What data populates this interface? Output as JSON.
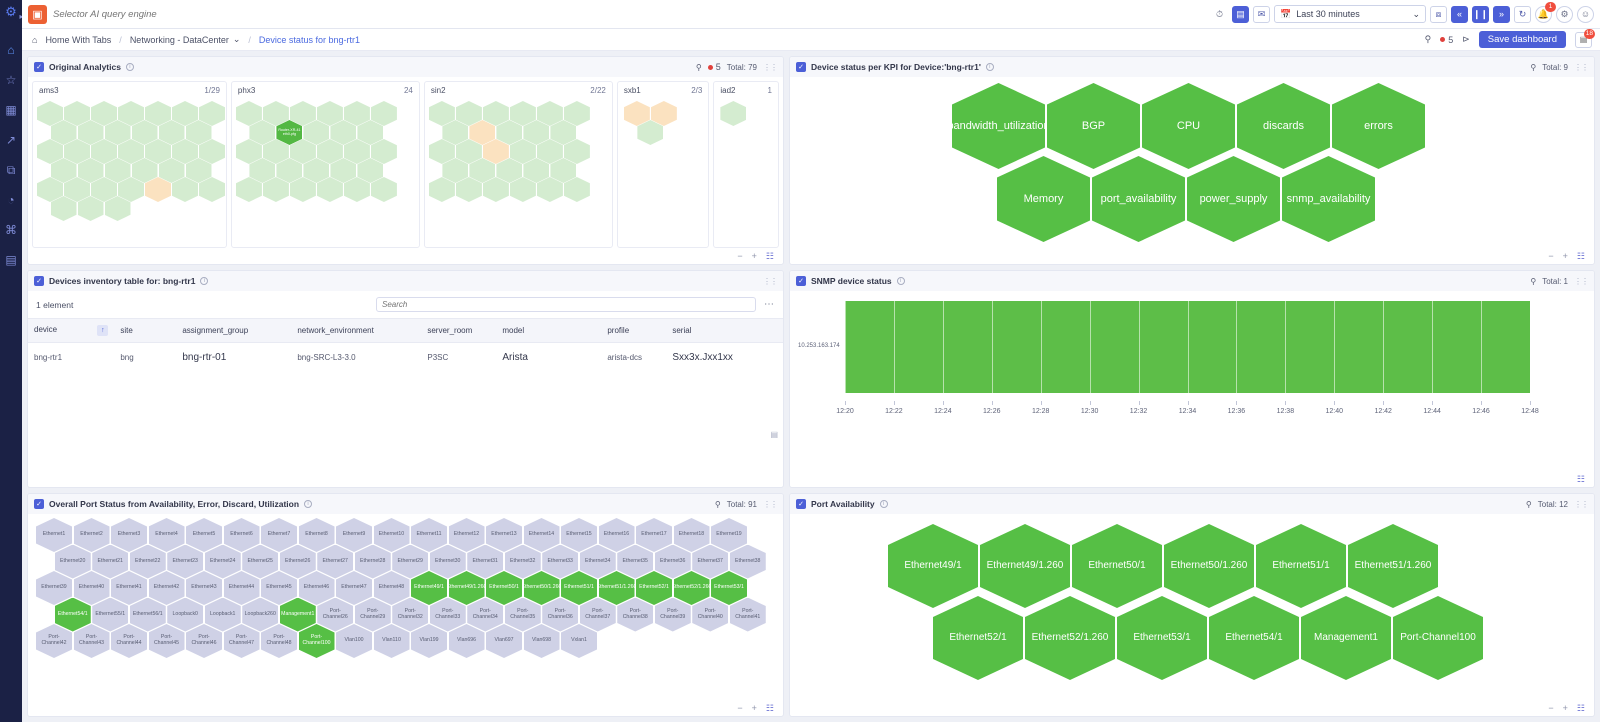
{
  "rail": {
    "logo_icon": "app-logo-icon",
    "collapse_icon": "chevron-right-icon",
    "items": [
      {
        "name": "home",
        "glyph": "⌂"
      },
      {
        "name": "favorites",
        "glyph": "☆"
      },
      {
        "name": "dashboards",
        "glyph": "▦"
      },
      {
        "name": "analytics",
        "glyph": "↗"
      },
      {
        "name": "integrations",
        "glyph": "⧉"
      },
      {
        "name": "alerts",
        "glyph": "◔"
      },
      {
        "name": "topology",
        "glyph": "⌘"
      },
      {
        "name": "documents",
        "glyph": "▤"
      }
    ]
  },
  "topbar": {
    "selector_icon": "selector-logo-icon",
    "query_placeholder": "Selector AI query engine",
    "history_icon": "clock-icon",
    "layout_icon": "layout-icon",
    "comment_icon": "comment-icon",
    "time_range": "Last 30 minutes",
    "calendar_icon": "calendar-icon",
    "chevron_icon": "chevron-down-icon",
    "zoom_out_icon": "zoom-out-icon",
    "prev_icon": "«",
    "pause_icon": "pause-icon",
    "next_icon": "»",
    "refresh_icon": "refresh-icon",
    "bell_icon": "bell-icon",
    "bell_badge": "1",
    "settings_icon": "gear-icon",
    "avatar_icon": "user-avatar-icon"
  },
  "breadcrumb": {
    "home_icon": "home-icon",
    "items": [
      "Home With Tabs",
      "Networking - DataCenter",
      "Device status for bng-rtr1"
    ],
    "separator": "/",
    "dropdown_icon": "chevron-down-icon",
    "search_icon": "search-icon",
    "alert_count": "5",
    "share_icon": "share-icon",
    "save_label": "Save dashboard",
    "grid_icon": "grid-icon",
    "grid_badge": "18"
  },
  "panels": {
    "original_analytics": {
      "title": "Original Analytics",
      "info_icon": "info-icon",
      "search_icon": "search-icon",
      "alert_count": "5",
      "total_label": "Total: 79",
      "drag_icon": "drag-handle-icon",
      "sites": [
        {
          "name": "ams3",
          "count": "1/29"
        },
        {
          "name": "phx3",
          "count": "24"
        },
        {
          "name": "sin2",
          "count": "2/22"
        },
        {
          "name": "sxb1",
          "count": "2/3"
        },
        {
          "name": "iad2",
          "count": "1"
        }
      ],
      "highlighted_node": "Router-XR-41 eth0-pfg",
      "footer": {
        "minus_icon": "zoom-out-icon",
        "plus_icon": "zoom-in-icon",
        "layout_icon": "layout-icon"
      }
    },
    "device_kpi": {
      "title": "Device status per KPI for Device:'bng-rtr1'",
      "info_icon": "info-icon",
      "search_icon": "search-icon",
      "total_label": "Total: 9",
      "drag_icon": "drag-handle-icon",
      "row1": [
        "bandwidth_utilization",
        "BGP",
        "CPU",
        "discards",
        "errors"
      ],
      "row2": [
        "Memory",
        "port_availability",
        "power_supply",
        "snmp_availability"
      ],
      "footer": {
        "minus_icon": "zoom-out-icon",
        "plus_icon": "zoom-in-icon",
        "layout_icon": "layout-icon"
      }
    },
    "inventory": {
      "title": "Devices inventory table for: bng-rtr1",
      "info_icon": "info-icon",
      "element_count": "1 element",
      "search_placeholder": "Search",
      "more_icon": "more-options-icon",
      "drag_icon": "drag-handle-icon",
      "sort_icon": "sort-ascending-icon",
      "columns": [
        "device",
        "site",
        "assignment_group",
        "network_environment",
        "server_room",
        "model",
        "profile",
        "serial"
      ],
      "rows": [
        {
          "device": "bng-rtr1",
          "site": "bng",
          "assignment_group": "bng-rtr-01",
          "network_environment": "bng-SRC-L3-3.0",
          "server_room": "P3SC",
          "model": "Arista",
          "profile": "arista-dcs",
          "serial": "Sxx3x.Jxx1xx"
        }
      ]
    },
    "snmp": {
      "title": "SNMP device status",
      "info_icon": "info-icon",
      "search_icon": "search-icon",
      "total_label": "Total: 1",
      "drag_icon": "drag-handle-icon",
      "footer": {
        "layout_icon": "layout-icon"
      }
    },
    "port_status": {
      "title": "Overall Port Status from Availability, Error, Discard, Utilization",
      "info_icon": "info-icon",
      "search_icon": "search-icon",
      "total_label": "Total: 91",
      "drag_icon": "drag-handle-icon",
      "footer": {
        "minus_icon": "zoom-out-icon",
        "plus_icon": "zoom-in-icon",
        "layout_icon": "layout-icon"
      }
    },
    "port_availability": {
      "title": "Port Availability",
      "info_icon": "info-icon",
      "search_icon": "search-icon",
      "total_label": "Total: 12",
      "drag_icon": "drag-handle-icon",
      "row1": [
        "Ethernet49/1",
        "Ethernet49/1.260",
        "Ethernet50/1",
        "Ethernet50/1.260",
        "Ethernet51/1",
        "Ethernet51/1.260"
      ],
      "row2": [
        "Ethernet52/1",
        "Ethernet52/1.260",
        "Ethernet53/1",
        "Ethernet54/1",
        "Management1",
        "Port-Channel100"
      ],
      "footer": {
        "minus_icon": "zoom-out-icon",
        "plus_icon": "zoom-in-icon",
        "layout_icon": "layout-icon"
      }
    }
  },
  "chart_data": {
    "type": "heatmap",
    "title": "SNMP device status",
    "ylabel": "",
    "xlabel": "",
    "yticks": [
      "10.253.163.174"
    ],
    "series": [
      {
        "name": "10.253.163.174",
        "status": "up",
        "color": "#5dbe48",
        "coverage": 1.0
      }
    ],
    "xticks": [
      "12:20",
      "12:22",
      "12:24",
      "12:26",
      "12:28",
      "12:30",
      "12:32",
      "12:34",
      "12:36",
      "12:38",
      "12:40",
      "12:42",
      "12:44",
      "12:46",
      "12:48"
    ],
    "grid": true,
    "legend": "none"
  },
  "port_grid": {
    "rows": [
      {
        "offset": 0,
        "cells": [
          {
            "label": "Ethernet1",
            "state": "idle"
          },
          {
            "label": "Ethernet2",
            "state": "idle"
          },
          {
            "label": "Ethernet3",
            "state": "idle"
          },
          {
            "label": "Ethernet4",
            "state": "idle"
          },
          {
            "label": "Ethernet5",
            "state": "idle"
          },
          {
            "label": "Ethernet6",
            "state": "idle"
          },
          {
            "label": "Ethernet7",
            "state": "idle"
          },
          {
            "label": "Ethernet8",
            "state": "idle"
          },
          {
            "label": "Ethernet9",
            "state": "idle"
          },
          {
            "label": "Ethernet10",
            "state": "idle"
          },
          {
            "label": "Ethernet11",
            "state": "idle"
          },
          {
            "label": "Ethernet12",
            "state": "idle"
          },
          {
            "label": "Ethernet13",
            "state": "idle"
          },
          {
            "label": "Ethernet14",
            "state": "idle"
          },
          {
            "label": "Ethernet15",
            "state": "idle"
          },
          {
            "label": "Ethernet16",
            "state": "idle"
          },
          {
            "label": "Ethernet17",
            "state": "idle"
          },
          {
            "label": "Ethernet18",
            "state": "idle"
          },
          {
            "label": "Ethernet19",
            "state": "idle"
          }
        ]
      },
      {
        "offset": 1,
        "cells": [
          {
            "label": "Ethernet20",
            "state": "idle"
          },
          {
            "label": "Ethernet21",
            "state": "idle"
          },
          {
            "label": "Ethernet22",
            "state": "idle"
          },
          {
            "label": "Ethernet23",
            "state": "idle"
          },
          {
            "label": "Ethernet24",
            "state": "idle"
          },
          {
            "label": "Ethernet25",
            "state": "idle"
          },
          {
            "label": "Ethernet26",
            "state": "idle"
          },
          {
            "label": "Ethernet27",
            "state": "idle"
          },
          {
            "label": "Ethernet28",
            "state": "idle"
          },
          {
            "label": "Ethernet29",
            "state": "idle"
          },
          {
            "label": "Ethernet30",
            "state": "idle"
          },
          {
            "label": "Ethernet31",
            "state": "idle"
          },
          {
            "label": "Ethernet32",
            "state": "idle"
          },
          {
            "label": "Ethernet33",
            "state": "idle"
          },
          {
            "label": "Ethernet34",
            "state": "idle"
          },
          {
            "label": "Ethernet35",
            "state": "idle"
          },
          {
            "label": "Ethernet36",
            "state": "idle"
          },
          {
            "label": "Ethernet37",
            "state": "idle"
          },
          {
            "label": "Ethernet38",
            "state": "idle"
          }
        ]
      },
      {
        "offset": 0,
        "cells": [
          {
            "label": "Ethernet39",
            "state": "idle"
          },
          {
            "label": "Ethernet40",
            "state": "idle"
          },
          {
            "label": "Ethernet41",
            "state": "idle"
          },
          {
            "label": "Ethernet42",
            "state": "idle"
          },
          {
            "label": "Ethernet43",
            "state": "idle"
          },
          {
            "label": "Ethernet44",
            "state": "idle"
          },
          {
            "label": "Ethernet45",
            "state": "idle"
          },
          {
            "label": "Ethernet46",
            "state": "idle"
          },
          {
            "label": "Ethernet47",
            "state": "idle"
          },
          {
            "label": "Ethernet48",
            "state": "idle"
          },
          {
            "label": "Ethernet49/1",
            "state": "ok"
          },
          {
            "label": "Ethernet49/1.260",
            "state": "ok"
          },
          {
            "label": "Ethernet50/1",
            "state": "ok"
          },
          {
            "label": "Ethernet50/1.260",
            "state": "ok"
          },
          {
            "label": "Ethernet51/1",
            "state": "ok"
          },
          {
            "label": "Ethernet51/1.260",
            "state": "ok"
          },
          {
            "label": "Ethernet52/1",
            "state": "ok"
          },
          {
            "label": "Ethernet52/1.260",
            "state": "ok"
          },
          {
            "label": "Ethernet53/1",
            "state": "ok"
          }
        ]
      },
      {
        "offset": 1,
        "cells": [
          {
            "label": "Ethernet54/1",
            "state": "ok"
          },
          {
            "label": "Ethernet55/1",
            "state": "idle"
          },
          {
            "label": "Ethernet56/1",
            "state": "idle"
          },
          {
            "label": "Loopback0",
            "state": "idle"
          },
          {
            "label": "Loopback1",
            "state": "idle"
          },
          {
            "label": "Loopback260",
            "state": "idle"
          },
          {
            "label": "Management1",
            "state": "ok"
          },
          {
            "label": "Port-Channel26",
            "state": "idle"
          },
          {
            "label": "Port-Channel29",
            "state": "idle"
          },
          {
            "label": "Port-Channel32",
            "state": "idle"
          },
          {
            "label": "Port-Channel33",
            "state": "idle"
          },
          {
            "label": "Port-Channel34",
            "state": "idle"
          },
          {
            "label": "Port-Channel35",
            "state": "idle"
          },
          {
            "label": "Port-Channel36",
            "state": "idle"
          },
          {
            "label": "Port-Channel37",
            "state": "idle"
          },
          {
            "label": "Port-Channel38",
            "state": "idle"
          },
          {
            "label": "Port-Channel39",
            "state": "idle"
          },
          {
            "label": "Port-Channel40",
            "state": "idle"
          },
          {
            "label": "Port-Channel41",
            "state": "idle"
          }
        ]
      },
      {
        "offset": 0,
        "cells": [
          {
            "label": "Port-Channel42",
            "state": "idle"
          },
          {
            "label": "Port-Channel43",
            "state": "idle"
          },
          {
            "label": "Port-Channel44",
            "state": "idle"
          },
          {
            "label": "Port-Channel45",
            "state": "idle"
          },
          {
            "label": "Port-Channel46",
            "state": "idle"
          },
          {
            "label": "Port-Channel47",
            "state": "idle"
          },
          {
            "label": "Port-Channel48",
            "state": "idle"
          },
          {
            "label": "Port-Channel100",
            "state": "ok"
          },
          {
            "label": "Vlan100",
            "state": "idle"
          },
          {
            "label": "Vlan110",
            "state": "idle"
          },
          {
            "label": "Vlan199",
            "state": "idle"
          },
          {
            "label": "Vlan696",
            "state": "idle"
          },
          {
            "label": "Vlan697",
            "state": "idle"
          },
          {
            "label": "Vlan698",
            "state": "idle"
          },
          {
            "label": "Vxlan1",
            "state": "idle"
          }
        ]
      }
    ]
  },
  "site_grids": {
    "ams3": {
      "cols": 7,
      "rows": 6,
      "pale": 29,
      "amber": [
        31
      ],
      "green": []
    },
    "phx3": {
      "cols": 6,
      "rows": 5,
      "pale": 24,
      "amber": [],
      "green": [
        8
      ]
    },
    "sin2": {
      "cols": 6,
      "rows": 5,
      "pale": 22,
      "amber": [
        8,
        14
      ],
      "green": []
    },
    "sxb1": {
      "cols": 2,
      "rows": 2,
      "pale": 1,
      "amber": [
        1,
        2
      ],
      "green": []
    },
    "iad2": {
      "cols": 1,
      "rows": 1,
      "pale": 1,
      "amber": [],
      "green": []
    }
  }
}
